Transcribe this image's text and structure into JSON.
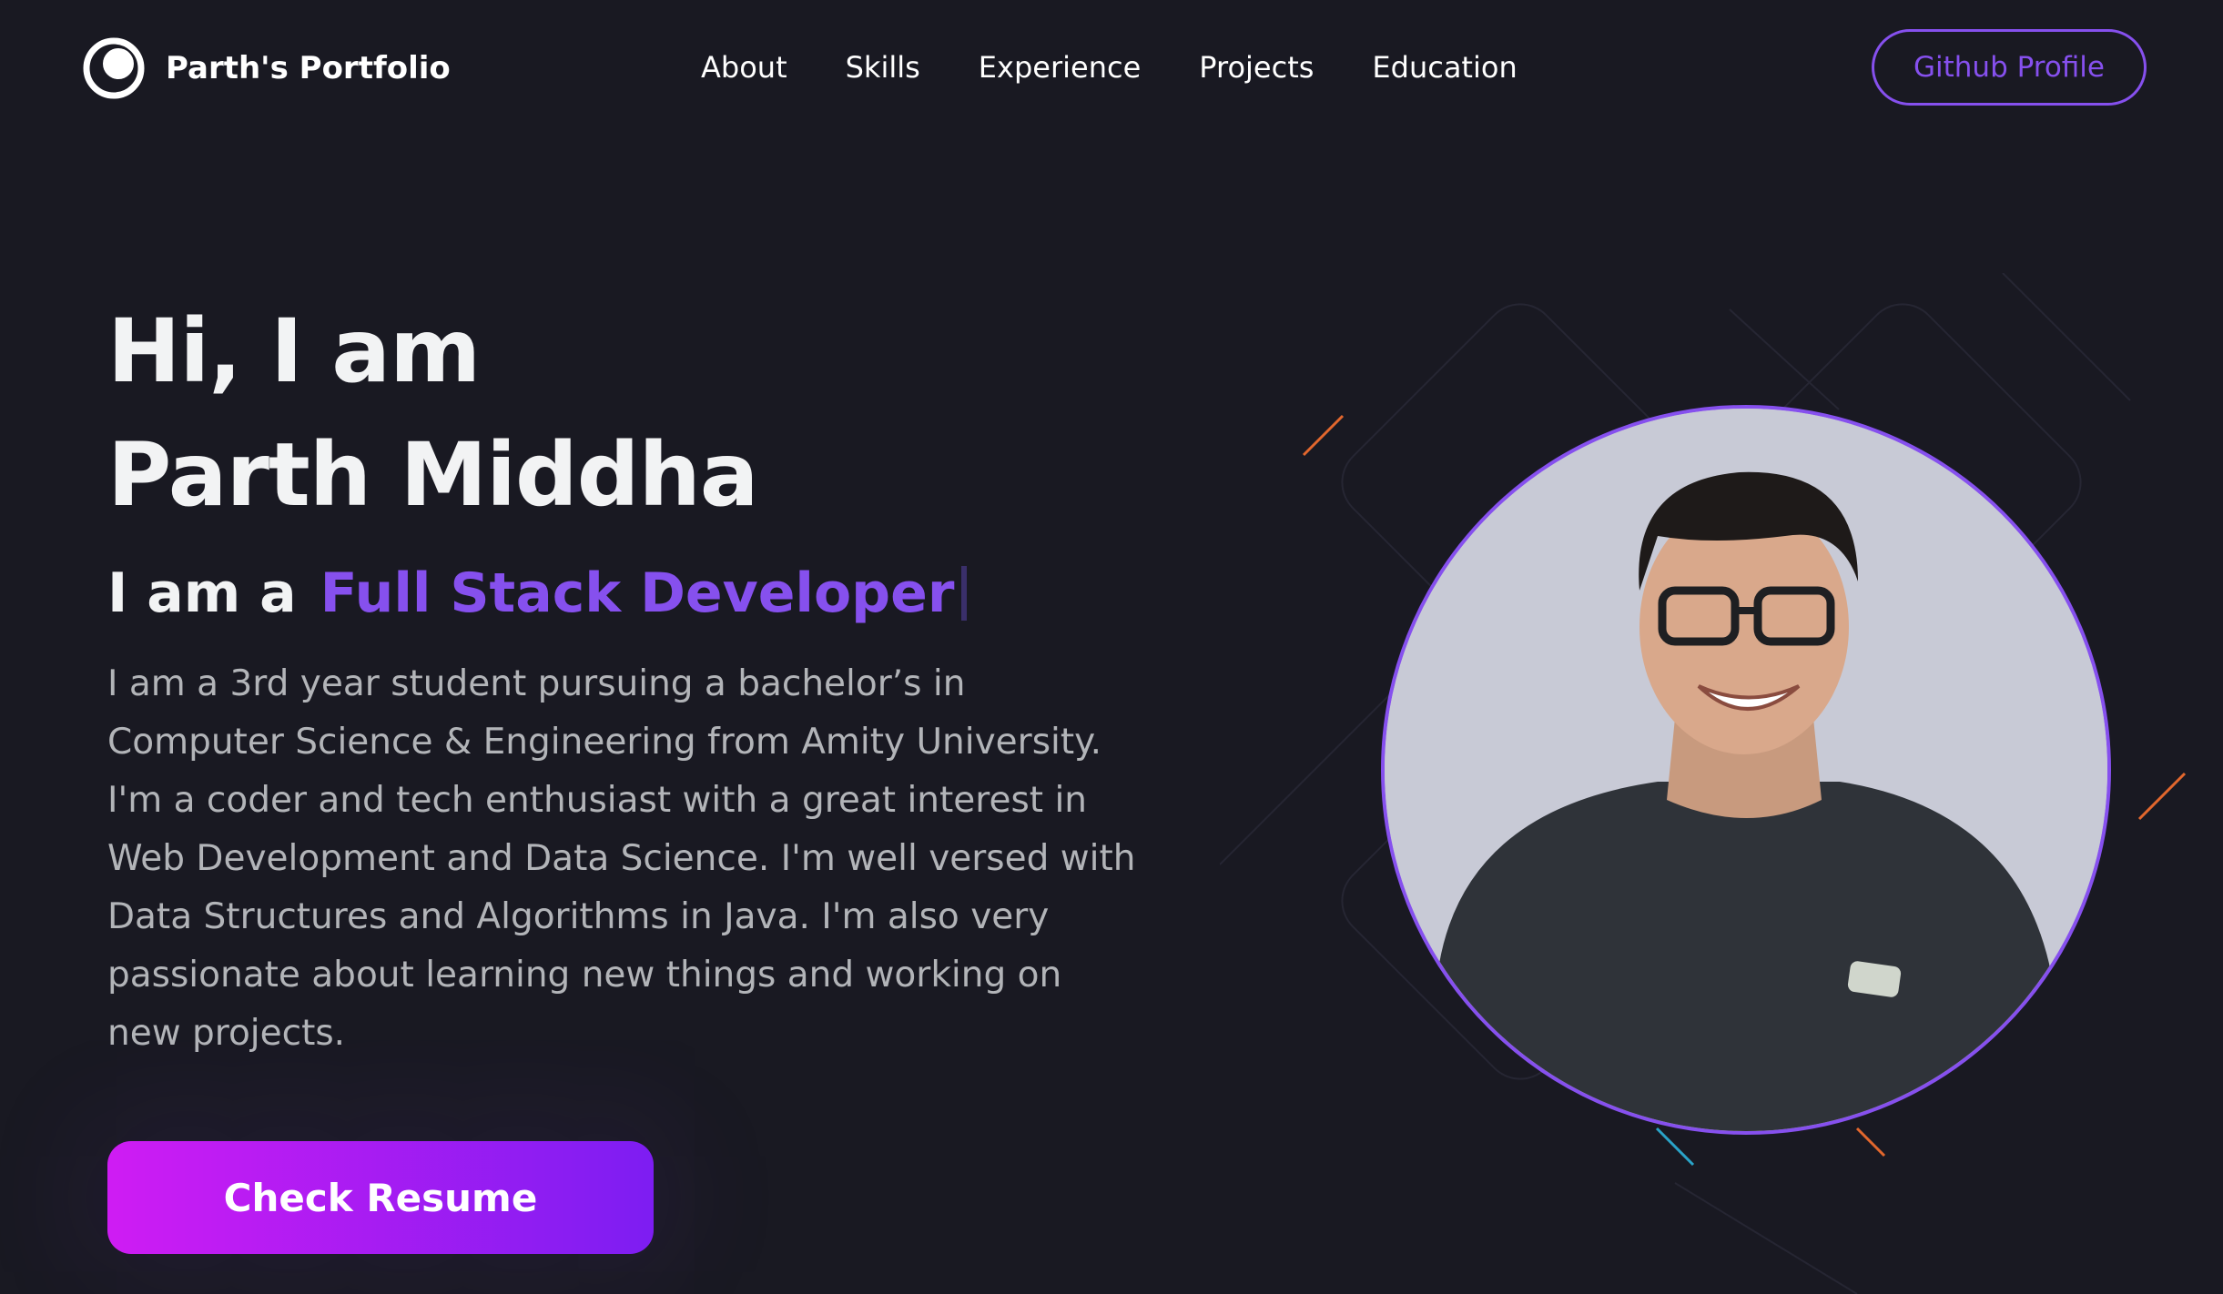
{
  "nav": {
    "brand": "Parth's Portfolio",
    "links": [
      "About",
      "Skills",
      "Experience",
      "Projects",
      "Education"
    ],
    "cta": "Github Profile"
  },
  "hero": {
    "greeting": "Hi, I am",
    "name": "Parth Middha",
    "role_prefix": "I am a",
    "role": "Full Stack Developer",
    "bio": "I am a 3rd year student pursuing a bachelor’s in Computer Science & Engineering from Amity University. I'm a coder and tech enthusiast with a great interest in Web Development and Data Science. I'm well versed with Data Structures and Algorithms in Java. I'm also very passionate about learning new things and working on new projects.",
    "resume_button": "Check Resume"
  },
  "colors": {
    "background": "#191922",
    "accent": "#8650ee",
    "button_gradient_start": "#cf1cf3",
    "button_gradient_end": "#7d1df2",
    "bio_text": "#b2b4b8"
  },
  "icons": {
    "brand": "logo-icon"
  }
}
